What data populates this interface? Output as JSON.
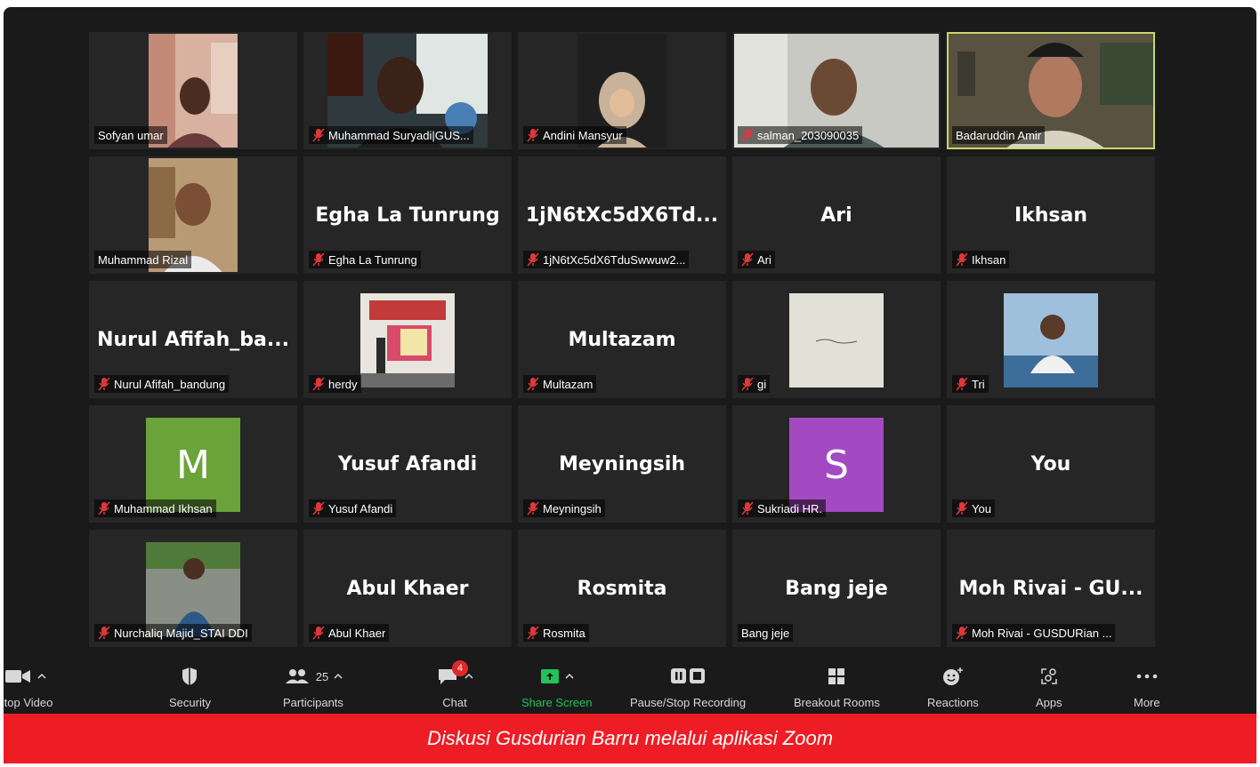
{
  "participants": [
    {
      "name": "Sofyan umar",
      "type": "video",
      "muted": false
    },
    {
      "name": "Muhammad Suryadi|GUS...",
      "type": "video",
      "muted": true
    },
    {
      "name": "Andini Mansyur",
      "type": "video",
      "muted": true
    },
    {
      "name": "salman_203090035",
      "type": "video",
      "muted": true
    },
    {
      "name": "Badaruddin Amir",
      "type": "video",
      "muted": false,
      "active_speaker": true
    },
    {
      "name": "Muhammad Rizal",
      "type": "video",
      "muted": false
    },
    {
      "name": "Egha La Tunrung",
      "display": "Egha La Tunrung",
      "type": "text",
      "muted": true
    },
    {
      "name": "1jN6tXc5dX6TduSwwuw2...",
      "display": "1jN6tXc5dX6Td...",
      "type": "text",
      "muted": true
    },
    {
      "name": "Ari",
      "display": "Ari",
      "type": "text",
      "muted": true
    },
    {
      "name": "Ikhsan",
      "display": "Ikhsan",
      "type": "text",
      "muted": true
    },
    {
      "name": "Nurul Afifah_bandung",
      "display": "Nurul  Afifah_ba...",
      "type": "text",
      "muted": true
    },
    {
      "name": "herdy",
      "type": "picture",
      "muted": true
    },
    {
      "name": "Multazam",
      "display": "Multazam",
      "type": "text",
      "muted": true
    },
    {
      "name": "gi",
      "type": "picture",
      "muted": true
    },
    {
      "name": "Tri",
      "type": "picture",
      "muted": true
    },
    {
      "name": "Muhammad Ikhsan",
      "type": "initial",
      "initial": "M",
      "color": "#6aa33a",
      "muted": true
    },
    {
      "name": "Yusuf Afandi",
      "display": "Yusuf Afandi",
      "type": "text",
      "muted": true
    },
    {
      "name": "Meyningsih",
      "display": "Meyningsih",
      "type": "text",
      "muted": true
    },
    {
      "name": "Sukriadi HR.",
      "type": "initial",
      "initial": "S",
      "color": "#a34ac2",
      "muted": true
    },
    {
      "name": "You",
      "display": "You",
      "type": "text",
      "muted": true
    },
    {
      "name": "Nurchaliq Majid_STAI DDI",
      "type": "picture",
      "muted": true
    },
    {
      "name": "Abul Khaer",
      "display": "Abul Khaer",
      "type": "text",
      "muted": true
    },
    {
      "name": "Rosmita",
      "display": "Rosmita",
      "type": "text",
      "muted": true
    },
    {
      "name": "Bang jeje",
      "display": "Bang jeje",
      "type": "text",
      "muted": false
    },
    {
      "name": "Moh Rivai - GUSDURian ...",
      "display": "Moh Rivai - GU...",
      "type": "text",
      "muted": true
    }
  ],
  "toolbar": {
    "video_label": "Stop Video",
    "security_label": "Security",
    "participants_label": "Participants",
    "participants_count": "25",
    "chat_label": "Chat",
    "chat_badge": "4",
    "share_label": "Share Screen",
    "record_label": "Pause/Stop Recording",
    "breakout_label": "Breakout Rooms",
    "reactions_label": "Reactions",
    "apps_label": "Apps",
    "more_label": "More"
  },
  "caption": "Diskusi Gusdurian Barru melalui aplikasi Zoom",
  "colors": {
    "active_border": "#c6d86a",
    "caption_bg": "#ee1c25",
    "share_green": "#22c15a",
    "mic_off": "#e0383a"
  }
}
